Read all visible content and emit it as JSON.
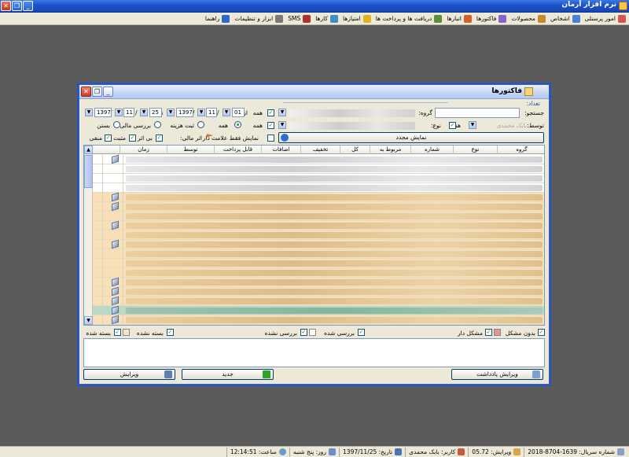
{
  "app": {
    "title": "نرم افزار آرمان",
    "window_buttons": {
      "minimize": "_",
      "restore": "❐",
      "close": "✕"
    }
  },
  "menu": [
    {
      "label": "امور پرسنلی",
      "icon": "people-icon",
      "color": "#d9534f"
    },
    {
      "label": "اشخاص",
      "icon": "person-icon",
      "color": "#4a7fd6"
    },
    {
      "label": "محصولات",
      "icon": "box-icon",
      "color": "#c48b2a"
    },
    {
      "label": "فاکتورها",
      "icon": "invoice-icon",
      "color": "#8a63c9"
    },
    {
      "label": "انبارها",
      "icon": "warehouse-icon",
      "color": "#d2602a"
    },
    {
      "label": "دریافت ها و پرداخت ها",
      "icon": "payment-icon",
      "color": "#5b8e3a"
    },
    {
      "label": "امتیازها",
      "icon": "star-icon",
      "color": "#e3b21d"
    },
    {
      "label": "کارها",
      "icon": "tasks-icon",
      "color": "#3d8fcc"
    },
    {
      "label": "SMS",
      "icon": "sms-icon",
      "color": "#b33030"
    },
    {
      "label": "ابزار و تنظیمات",
      "icon": "tools-icon",
      "color": "#7a7a7a"
    },
    {
      "label": "راهنما",
      "icon": "help-icon",
      "color": "#2f69c7"
    }
  ],
  "invoice_window": {
    "title": "فاکتورها",
    "count_label": "تعداد:",
    "search_label": "جستجو:",
    "group_label": "گروه:",
    "all_label": "همه",
    "type_label": "نوع:",
    "by_label": "توسط:",
    "by_value": "بابک محمدی",
    "from_label": "از",
    "to_label": "تا",
    "from_date": {
      "day": "01",
      "month": "11",
      "year": "1397"
    },
    "to_date": {
      "day": "25",
      "month": "11",
      "year": "1397"
    },
    "radios": [
      "همه",
      "ثبت هزینه",
      "بررسی مالی",
      "بستن"
    ],
    "refresh_button": "نمایش مجدد",
    "show_flagged": "نمایش فقط علامت دار",
    "financial_effect_label": "اثر مالی:",
    "effect_options": [
      "بی اثر",
      "مثبت",
      "منفی"
    ],
    "columns": [
      "گروه",
      "نوع",
      "شماره",
      "مربوط به",
      "کل",
      "تخفیف",
      "اضافات",
      "قابل پرداخت",
      "توسط",
      "زمان"
    ],
    "legend": {
      "no_problem": "بدون مشکل",
      "problematic": "مشکل دار",
      "reviewed": "بررسی شده",
      "not_reviewed": "بررسی نشده",
      "not_closed": "بسته نشده",
      "closed": "بسته شده"
    },
    "buttons": {
      "edit_note": "ویرایش یادداشت",
      "new": "جدید",
      "edit": "ویرایش"
    },
    "colors": {
      "row_tan": "#f8dfb6",
      "row_green": "#b9d8c6",
      "problem_swatch": "#e8939a",
      "closed_swatch": "#f6e6c4"
    }
  },
  "status": {
    "serial": "شماره سریال: 1639-8704-2018",
    "version": "ویرایش: 05.72",
    "user": "کاربر: بابک محمدی",
    "date": "تاریخ: 1397/11/25",
    "day": "روز: پنج شنبه",
    "time": "ساعت: 12:14:51"
  }
}
